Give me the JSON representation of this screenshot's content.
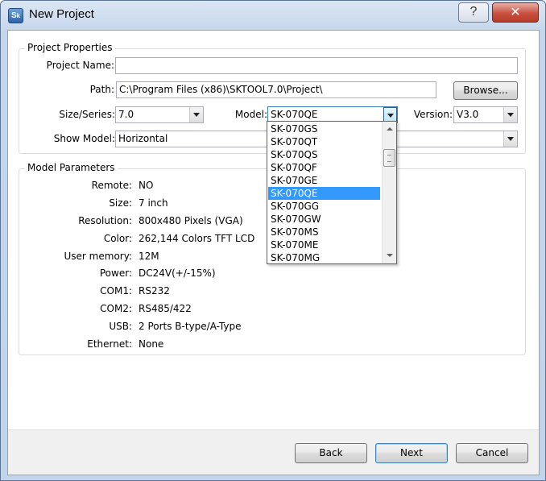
{
  "window": {
    "title": "New Project",
    "icon": "sk-app-icon",
    "help_label": "?",
    "close_label": "✕"
  },
  "properties": {
    "group_title": "Project Properties",
    "project_name_label": "Project Name:",
    "project_name_value": "",
    "path_label": "Path:",
    "path_value": "C:\\Program Files (x86)\\SKTOOL7.0\\Project\\",
    "browse_label": "Browse...",
    "size_series_label": "Size/Series:",
    "size_series_value": "7.0",
    "model_label": "Model:",
    "model_value": "SK-070QE",
    "version_label": "Version:",
    "version_value": "V3.0",
    "show_model_label": "Show Model:",
    "show_model_value": "Horizontal"
  },
  "model_dropdown": {
    "items": [
      "SK-070GS",
      "SK-070QT",
      "SK-070QS",
      "SK-070QF",
      "SK-070GE",
      "SK-070QE",
      "SK-070GG",
      "SK-070GW",
      "SK-070MS",
      "SK-070ME",
      "SK-070MG"
    ],
    "selected": "SK-070QE"
  },
  "parameters": {
    "group_title": "Model Parameters",
    "rows": [
      {
        "label": "Remote:",
        "value": "NO"
      },
      {
        "label": "Size:",
        "value": "7 inch"
      },
      {
        "label": "Resolution:",
        "value": "800x480 Pixels (VGA)"
      },
      {
        "label": "Color:",
        "value": "262,144 Colors TFT LCD"
      },
      {
        "label": "User memory:",
        "value": "12M"
      },
      {
        "label": "Power:",
        "value": "DC24V(+/-15%)"
      },
      {
        "label": "COM1:",
        "value": "RS232"
      },
      {
        "label": "COM2:",
        "value": "RS485/422"
      },
      {
        "label": "USB:",
        "value": "2 Ports B-type/A-Type"
      },
      {
        "label": "Ethernet:",
        "value": "None"
      }
    ]
  },
  "buttons": {
    "back": "Back",
    "next": "Next",
    "cancel": "Cancel"
  },
  "colors": {
    "selection": "#3399ff",
    "close_button": "#c7503f",
    "title_bar": "#c5d6ea"
  }
}
